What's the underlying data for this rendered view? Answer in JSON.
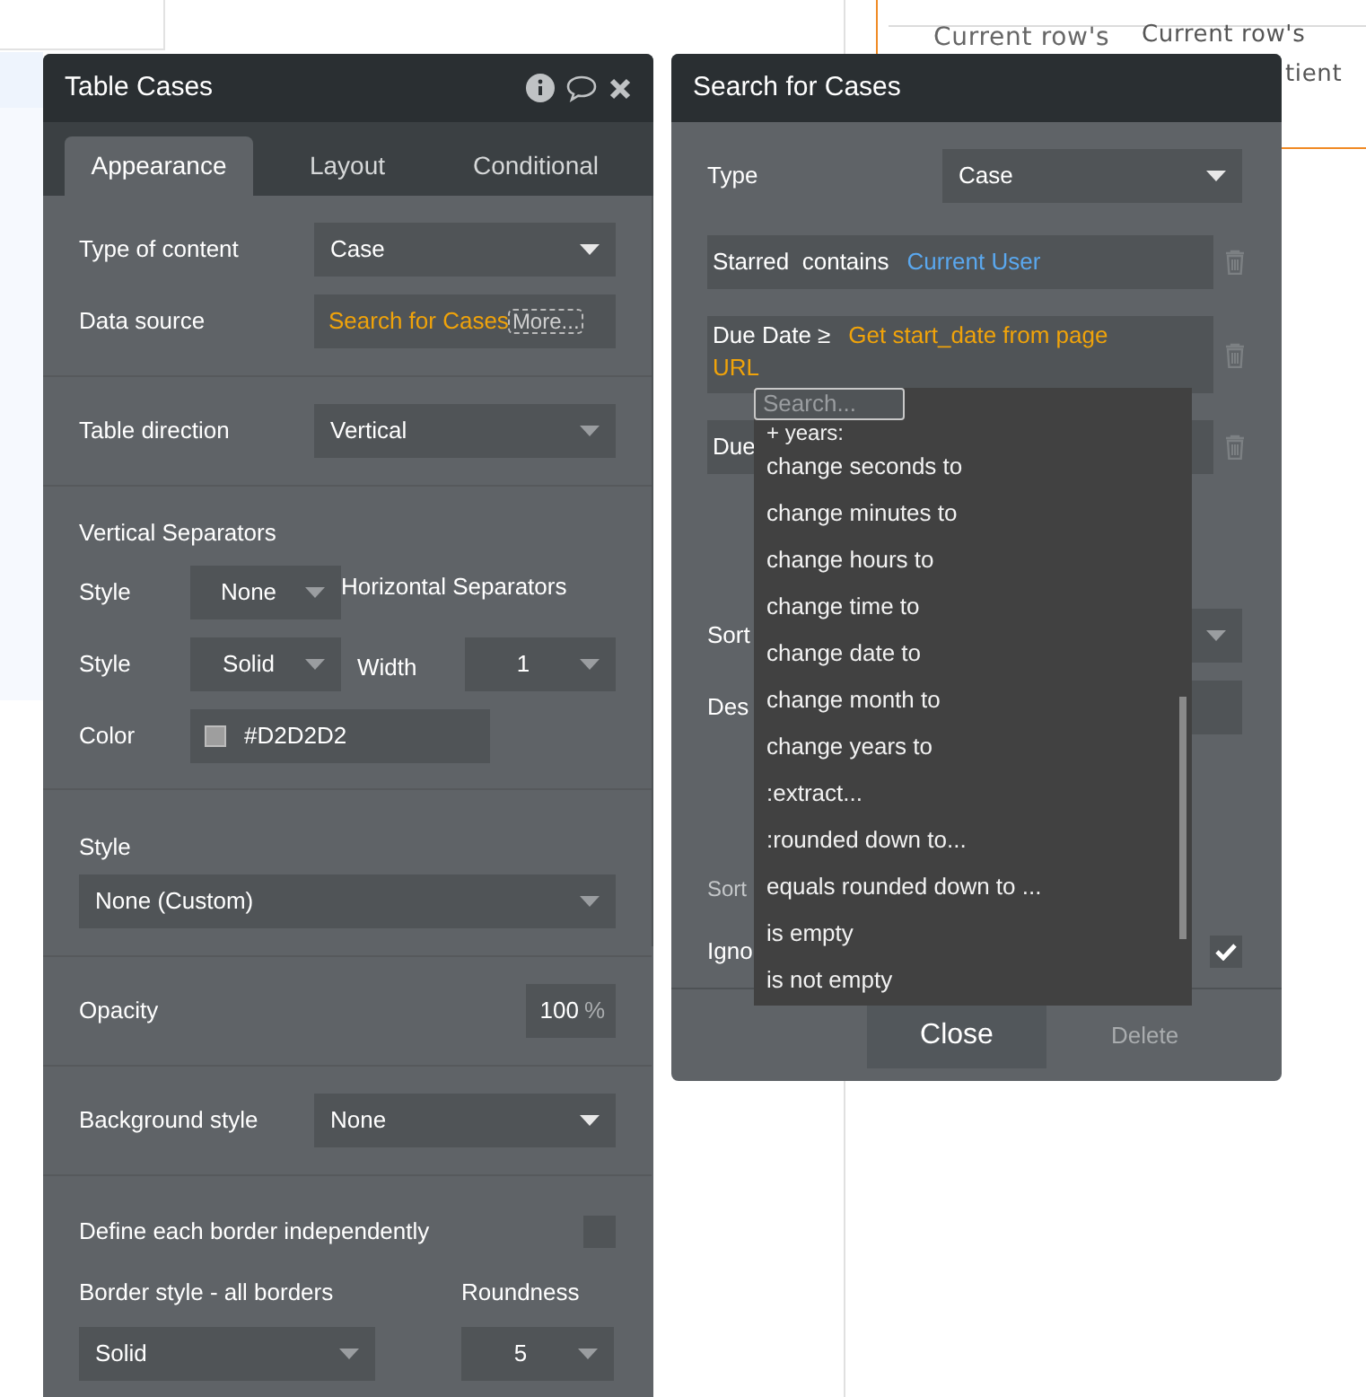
{
  "canvas": {
    "texts": [
      "Current row's",
      "Current row's",
      "tient"
    ]
  },
  "element_panel": {
    "title": "Table Cases",
    "tabs": [
      {
        "label": "Appearance",
        "selected": true
      },
      {
        "label": "Layout",
        "selected": false
      },
      {
        "label": "Conditional",
        "selected": false
      }
    ],
    "type_of_content": {
      "label": "Type of content",
      "value": "Case"
    },
    "data_source": {
      "label": "Data source",
      "value": "Search for Cases",
      "more": "More..."
    },
    "table_direction": {
      "label": "Table direction",
      "value": "Vertical"
    },
    "vertical_separators": {
      "heading": "Vertical Separators",
      "style_label": "Style",
      "style_value": "None"
    },
    "horizontal_separators": {
      "heading": "Horizontal Separators",
      "style_label": "Style",
      "style_value": "Solid",
      "width_label": "Width",
      "width_value": "1",
      "color_label": "Color",
      "color_value": "#D2D2D2"
    },
    "style": {
      "label": "Style",
      "value": "None (Custom)"
    },
    "opacity": {
      "label": "Opacity",
      "value": "100",
      "unit": "%"
    },
    "background_style": {
      "label": "Background style",
      "value": "None"
    },
    "define_borders": {
      "label": "Define each border independently",
      "checked": false
    },
    "border_style": {
      "label": "Border style - all borders",
      "value": "Solid"
    },
    "roundness": {
      "label": "Roundness",
      "value": "5"
    }
  },
  "search_panel": {
    "title": "Search for Cases",
    "type": {
      "label": "Type",
      "value": "Case"
    },
    "constraints": [
      {
        "field": "Starred  contains",
        "value": "Current User",
        "color": "#5aa8ef"
      },
      {
        "field": "Due Date ≥",
        "value": "Get start_date from page URL",
        "color": "#f0a30a"
      },
      {
        "field": "Due"
      }
    ],
    "sort_label": "Sort",
    "desc_label": "Des",
    "sorted_label": "Sort",
    "ignore": {
      "label": "Igno",
      "checked": true
    },
    "close": "Close",
    "delete": "Delete",
    "dropdown": {
      "placeholder": "Search...",
      "items": [
        "+ years:",
        "change seconds to",
        "change minutes to",
        "change hours to",
        "change time to",
        "change date to",
        "change month to",
        "change years to",
        ":extract...",
        ":rounded down to...",
        "equals rounded down to ...",
        "is empty",
        "is not empty"
      ]
    }
  }
}
